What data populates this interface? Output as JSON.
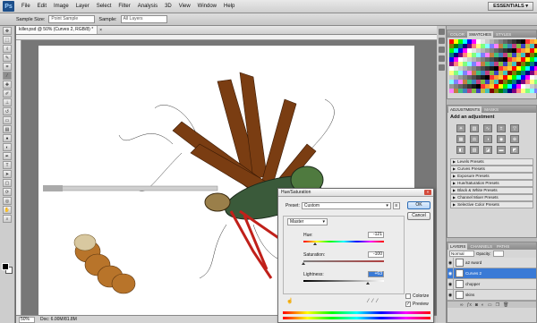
{
  "menubar": {
    "logo": "Ps",
    "items": [
      "File",
      "Edit",
      "Image",
      "Layer",
      "Select",
      "Filter",
      "Analysis",
      "3D",
      "View",
      "Window",
      "Help"
    ],
    "workspace": "ESSENTIALS ▾"
  },
  "options": {
    "sample_size_label": "Sample Size:",
    "sample_size_value": "Point Sample",
    "sample_label": "Sample:",
    "sample_value": "All Layers"
  },
  "document": {
    "tab_title": "killer.psd @ 50% (Curves 2, RGB/8) *",
    "zoom": "50%",
    "doc_info": "Doc: 6.00M/81.8M"
  },
  "panels": {
    "color_tabs": [
      "COLOR",
      "SWATCHES",
      "STYLES"
    ],
    "adjustments_tabs": [
      "ADJUSTMENTS",
      "MASKS"
    ],
    "adjustments_title": "Add an adjustment",
    "presets": [
      "Levels Presets",
      "Curves Presets",
      "Exposure Presets",
      "Hue/Saturation Presets",
      "Black & White Presets",
      "Channel Mixer Presets",
      "Selective Color Presets"
    ],
    "layers_tabs": [
      "LAYERS",
      "CHANNELS",
      "PATHS"
    ],
    "blend_mode": "Normal",
    "opacity_label": "Opacity:",
    "layers": [
      {
        "name": "a2 sword",
        "selected": false
      },
      {
        "name": "Curves 2",
        "selected": true
      },
      {
        "name": "chopper",
        "selected": false
      },
      {
        "name": "skins",
        "selected": false
      }
    ]
  },
  "dialog": {
    "title": "Hue/Saturation",
    "preset_label": "Preset:",
    "preset_value": "Custom",
    "ok": "OK",
    "cancel": "Cancel",
    "channel": "Master",
    "hue_label": "Hue:",
    "hue_value": "-121",
    "saturation_label": "Saturation:",
    "saturation_value": "-100",
    "lightness_label": "Lightness:",
    "lightness_value": "+63",
    "colorize_label": "Colorize",
    "preview_label": "Preview"
  },
  "swatch_colors": [
    "#ff0000",
    "#ffff00",
    "#00ff00",
    "#00ffff",
    "#0000ff",
    "#ff00ff",
    "#ffffff",
    "#e6e6e6",
    "#cccccc",
    "#b3b3b3",
    "#999999",
    "#808080",
    "#666666",
    "#4d4d4d",
    "#333333",
    "#1a1a1a",
    "#000000",
    "#ff3333",
    "#ff9933",
    "#ffcc33"
  ]
}
